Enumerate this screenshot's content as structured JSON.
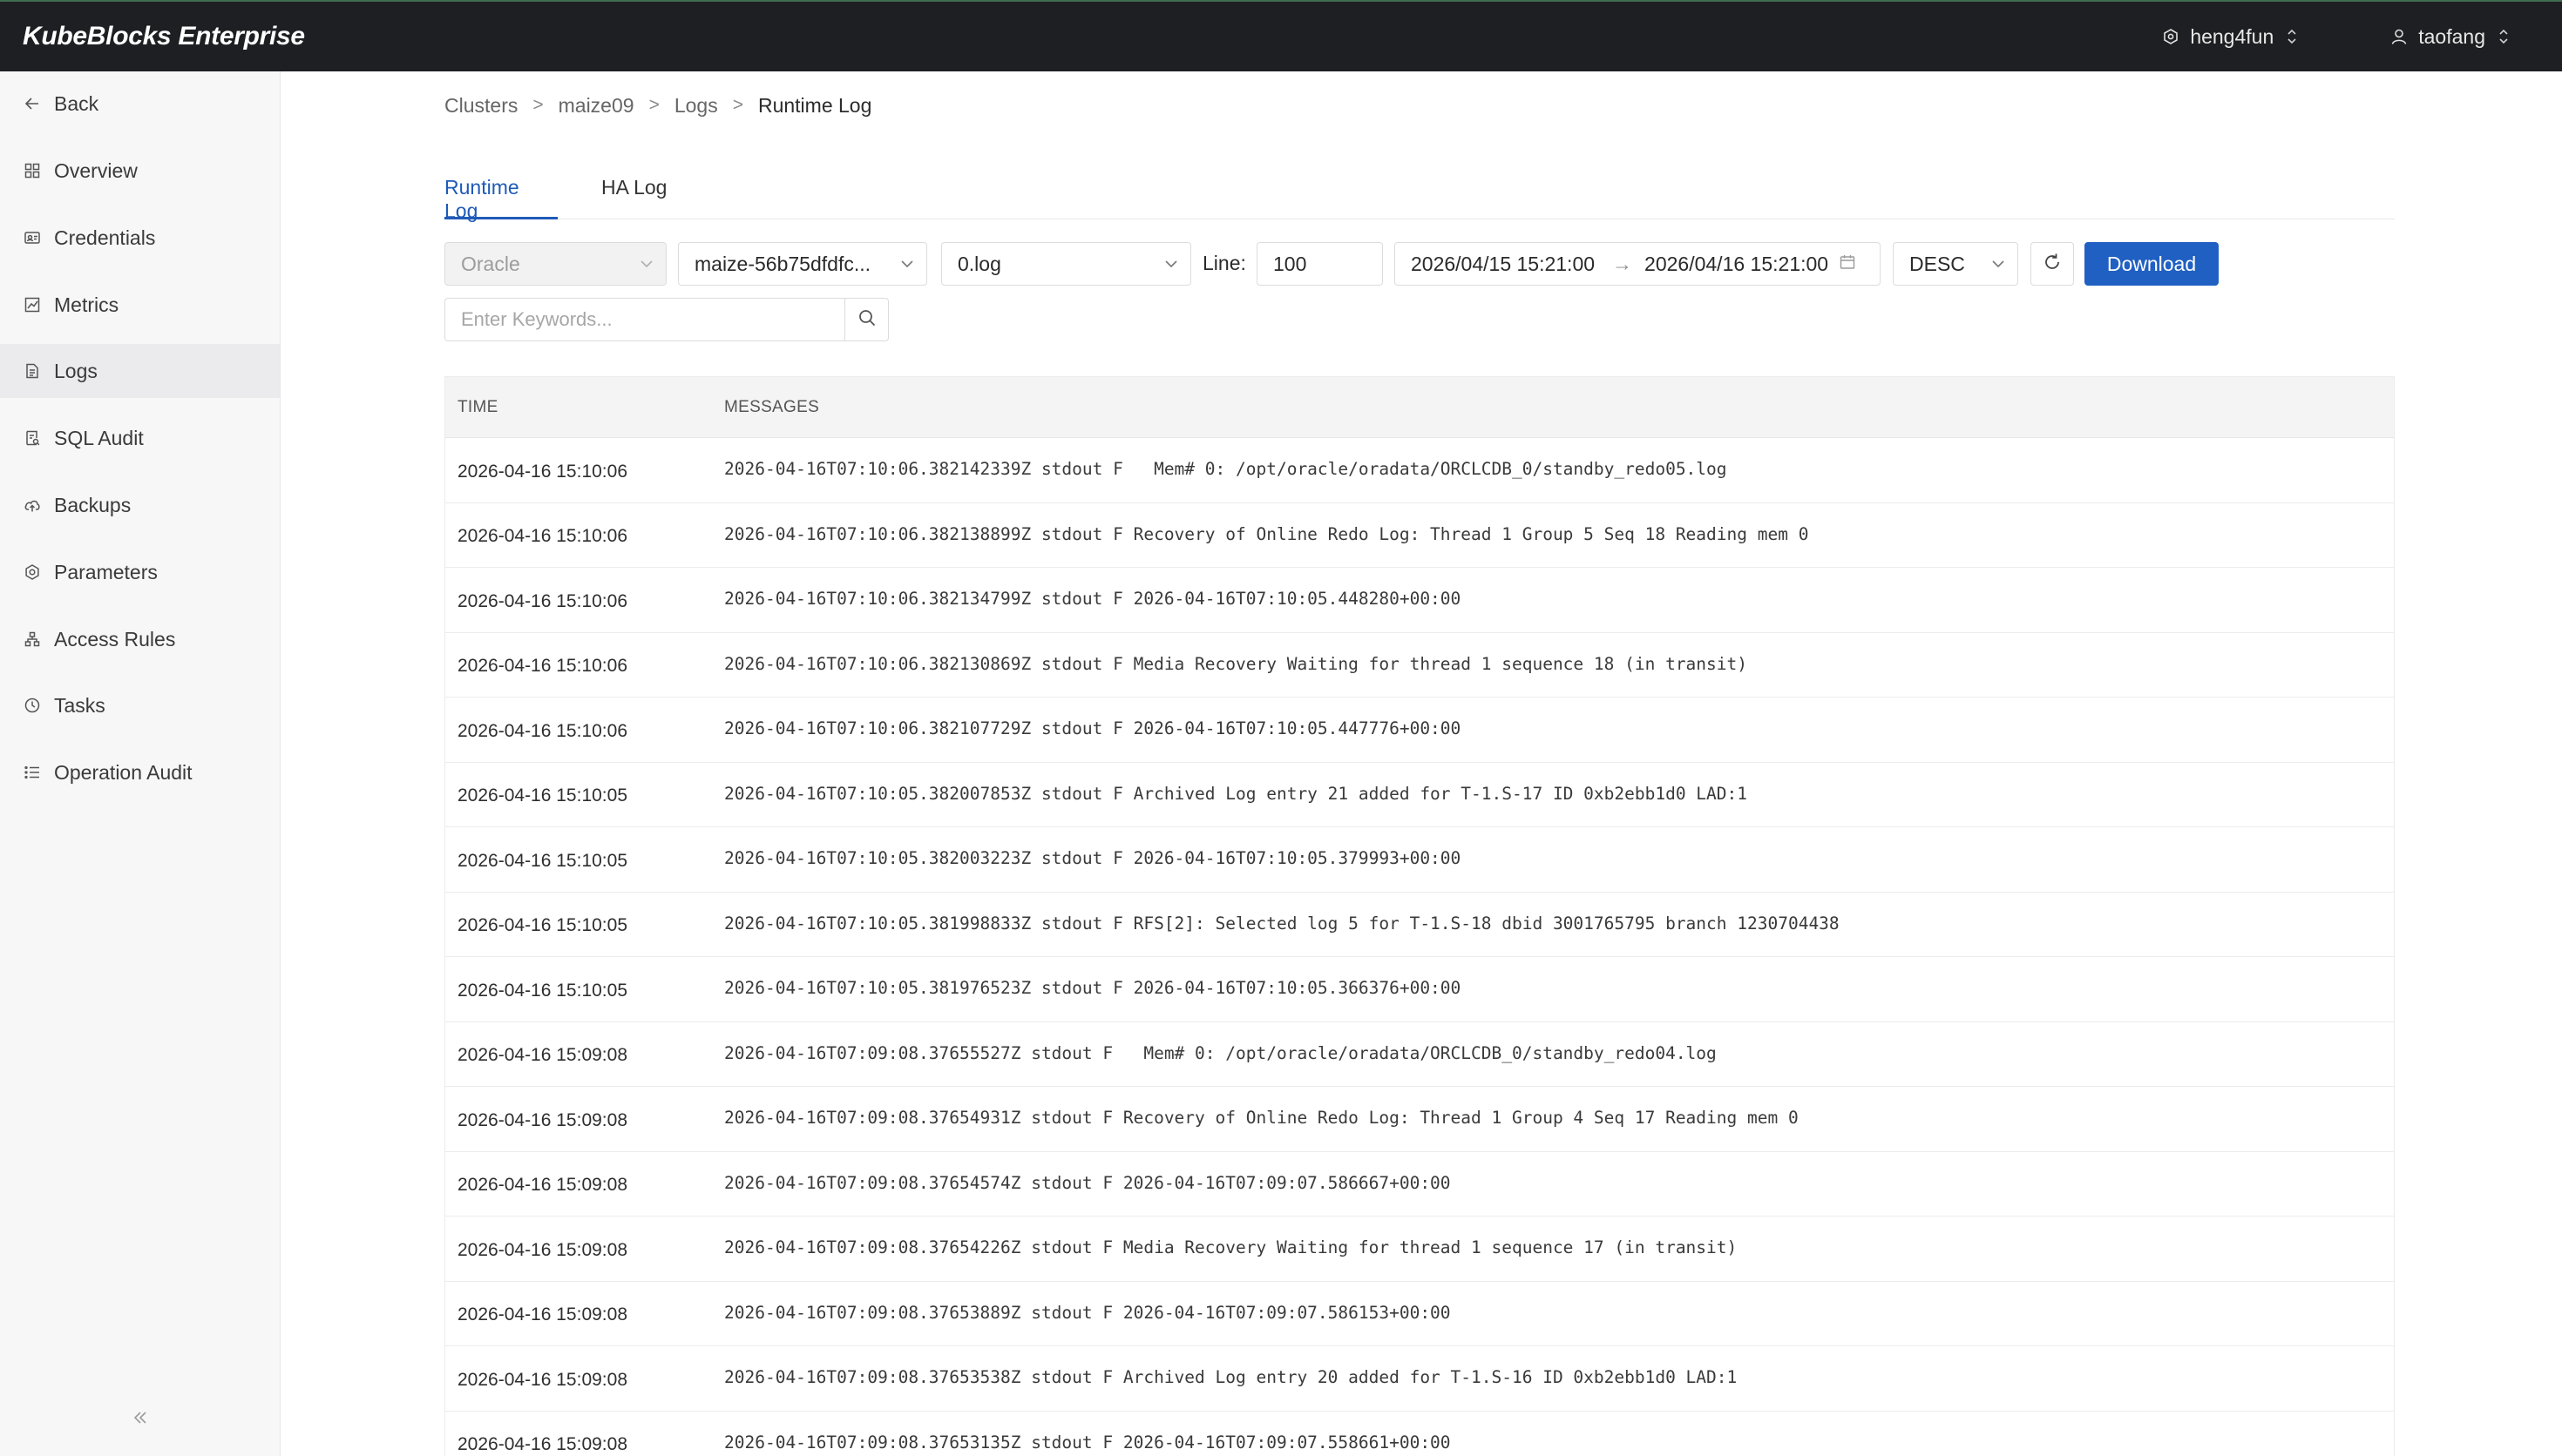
{
  "topbar": {
    "brand": "KubeBlocks Enterprise",
    "namespace": "heng4fun",
    "user": "taofang"
  },
  "sidebar": {
    "items": [
      {
        "label": "Back",
        "icon": "arrow-left-icon"
      },
      {
        "label": "Overview",
        "icon": "grid-icon"
      },
      {
        "label": "Credentials",
        "icon": "id-card-icon"
      },
      {
        "label": "Metrics",
        "icon": "chart-icon"
      },
      {
        "label": "Logs",
        "icon": "file-icon",
        "active": true
      },
      {
        "label": "SQL Audit",
        "icon": "audit-file-icon"
      },
      {
        "label": "Backups",
        "icon": "cloud-upload-icon"
      },
      {
        "label": "Parameters",
        "icon": "gear-icon"
      },
      {
        "label": "Access Rules",
        "icon": "network-icon"
      },
      {
        "label": "Tasks",
        "icon": "clock-icon"
      },
      {
        "label": "Operation Audit",
        "icon": "list-icon"
      }
    ]
  },
  "breadcrumb": {
    "items": [
      "Clusters",
      "maize09",
      "Logs"
    ],
    "sep": ">",
    "current": "Runtime Log"
  },
  "tabs": [
    "Runtime Log",
    "HA Log"
  ],
  "filters": {
    "engine": "Oracle",
    "pod": "maize-56b75dfdfc...",
    "file": "0.log",
    "line_label": "Line:",
    "line_value": "100",
    "start_time": "2026/04/15 15:21:00",
    "range_arrow": "→",
    "end_time": "2026/04/16 15:21:00",
    "order": "DESC",
    "download_label": "Download",
    "search_placeholder": "Enter Keywords..."
  },
  "table": {
    "headers": {
      "time": "TIME",
      "messages": "MESSAGES"
    },
    "rows": [
      {
        "time": "2026-04-16 15:10:06",
        "msg": "2026-04-16T07:10:06.382142339Z stdout F   Mem# 0: /opt/oracle/oradata/ORCLCDB_0/standby_redo05.log"
      },
      {
        "time": "2026-04-16 15:10:06",
        "msg": "2026-04-16T07:10:06.382138899Z stdout F Recovery of Online Redo Log: Thread 1 Group 5 Seq 18 Reading mem 0"
      },
      {
        "time": "2026-04-16 15:10:06",
        "msg": "2026-04-16T07:10:06.382134799Z stdout F 2026-04-16T07:10:05.448280+00:00"
      },
      {
        "time": "2026-04-16 15:10:06",
        "msg": "2026-04-16T07:10:06.382130869Z stdout F Media Recovery Waiting for thread 1 sequence 18 (in transit)"
      },
      {
        "time": "2026-04-16 15:10:06",
        "msg": "2026-04-16T07:10:06.382107729Z stdout F 2026-04-16T07:10:05.447776+00:00"
      },
      {
        "time": "2026-04-16 15:10:05",
        "msg": "2026-04-16T07:10:05.382007853Z stdout F Archived Log entry 21 added for T-1.S-17 ID 0xb2ebb1d0 LAD:1"
      },
      {
        "time": "2026-04-16 15:10:05",
        "msg": "2026-04-16T07:10:05.382003223Z stdout F 2026-04-16T07:10:05.379993+00:00"
      },
      {
        "time": "2026-04-16 15:10:05",
        "msg": "2026-04-16T07:10:05.381998833Z stdout F RFS[2]: Selected log 5 for T-1.S-18 dbid 3001765795 branch 1230704438"
      },
      {
        "time": "2026-04-16 15:10:05",
        "msg": "2026-04-16T07:10:05.381976523Z stdout F 2026-04-16T07:10:05.366376+00:00"
      },
      {
        "time": "2026-04-16 15:09:08",
        "msg": "2026-04-16T07:09:08.37655527Z stdout F   Mem# 0: /opt/oracle/oradata/ORCLCDB_0/standby_redo04.log"
      },
      {
        "time": "2026-04-16 15:09:08",
        "msg": "2026-04-16T07:09:08.37654931Z stdout F Recovery of Online Redo Log: Thread 1 Group 4 Seq 17 Reading mem 0"
      },
      {
        "time": "2026-04-16 15:09:08",
        "msg": "2026-04-16T07:09:08.37654574Z stdout F 2026-04-16T07:09:07.586667+00:00"
      },
      {
        "time": "2026-04-16 15:09:08",
        "msg": "2026-04-16T07:09:08.37654226Z stdout F Media Recovery Waiting for thread 1 sequence 17 (in transit)"
      },
      {
        "time": "2026-04-16 15:09:08",
        "msg": "2026-04-16T07:09:08.37653889Z stdout F 2026-04-16T07:09:07.586153+00:00"
      },
      {
        "time": "2026-04-16 15:09:08",
        "msg": "2026-04-16T07:09:08.37653538Z stdout F Archived Log entry 20 added for T-1.S-16 ID 0xb2ebb1d0 LAD:1"
      },
      {
        "time": "2026-04-16 15:09:08",
        "msg": "2026-04-16T07:09:08.37653135Z stdout F 2026-04-16T07:09:07.558661+00:00"
      }
    ]
  },
  "colors": {
    "primary": "#2060c2",
    "topbar": "#1e1f22",
    "active_tab": "#1f5ab8"
  }
}
